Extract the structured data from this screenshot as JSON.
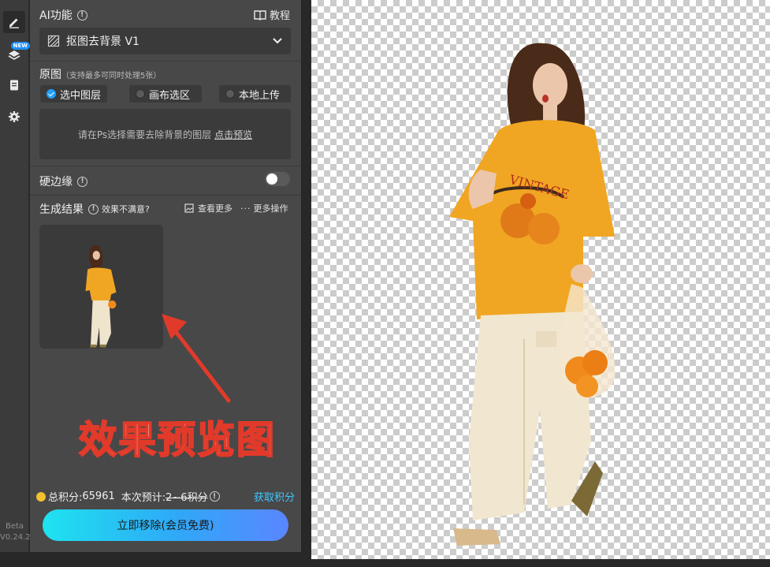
{
  "toolbar": {
    "new_badge": "NEW",
    "version_line1": "Beta",
    "version_line2": "V0.24.2"
  },
  "ai_section": {
    "title": "AI功能",
    "tutorial_label": "教程",
    "dropdown_value": "抠图去背景 V1"
  },
  "source_section": {
    "title": "原图",
    "subtitle": "（支持最多可同时处理5张）",
    "options": [
      {
        "label": "选中图层",
        "checked": true
      },
      {
        "label": "画布选区",
        "checked": false
      },
      {
        "label": "本地上传",
        "checked": false
      }
    ],
    "hint_text": "请在Ps选择需要去除背景的图层",
    "hint_link": "点击预览"
  },
  "hard_edge": {
    "title": "硬边缘",
    "enabled": false
  },
  "result_section": {
    "title": "生成结果",
    "unsatisfied_label": "效果不满意?",
    "view_more_label": "查看更多",
    "more_actions_label": "更多操作"
  },
  "annotation": {
    "text": "效果预览图",
    "color": "#e23a2a"
  },
  "footer": {
    "total_credits_label": "总积分:",
    "total_credits_value": "65961",
    "estimate_label": "本次预计:",
    "estimate_value": "2~6积分",
    "get_credits_label": "获取积分",
    "cta_label": "立即移除(会员免费)"
  },
  "colors": {
    "panel_bg": "#484848",
    "accent": "#1ea0ff",
    "link": "#3ec8ff",
    "shirt": "#f0a623"
  }
}
